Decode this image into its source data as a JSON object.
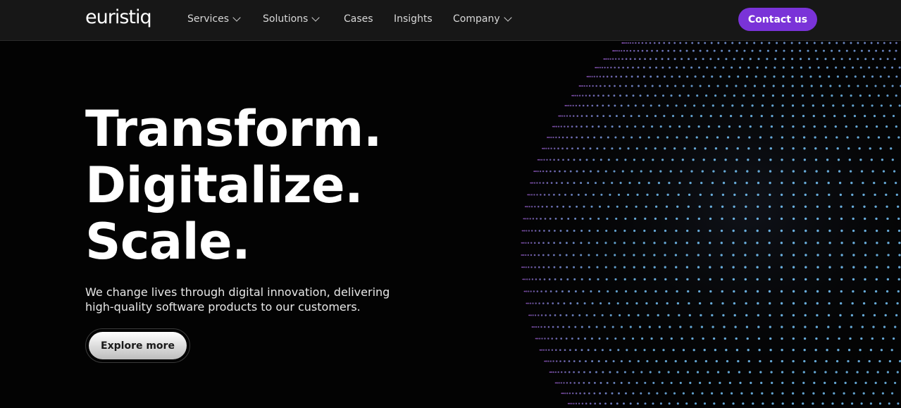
{
  "header": {
    "logo_text": "euristiq",
    "nav": [
      {
        "label": "Services",
        "has_dropdown": true
      },
      {
        "label": "Solutions",
        "has_dropdown": true
      },
      {
        "label": "Cases",
        "has_dropdown": false
      },
      {
        "label": "Insights",
        "has_dropdown": false
      },
      {
        "label": "Company",
        "has_dropdown": true
      }
    ],
    "contact_label": "Contact us"
  },
  "hero": {
    "title_lines": [
      "Transform.",
      "Digitalize.",
      "Scale."
    ],
    "subtitle_lines": [
      "We change lives through digital innovation, delivering",
      "high-quality software products to our customers."
    ],
    "cta_label": "Explore more"
  },
  "colors": {
    "accent": "#7a33d8",
    "header_bg": "#171717",
    "page_bg": "#030303",
    "sphere_edge": "#c070ff",
    "sphere_core": "#6fb8ea"
  },
  "icons": [
    "chevron-down-icon",
    "dot-sphere-graphic"
  ]
}
